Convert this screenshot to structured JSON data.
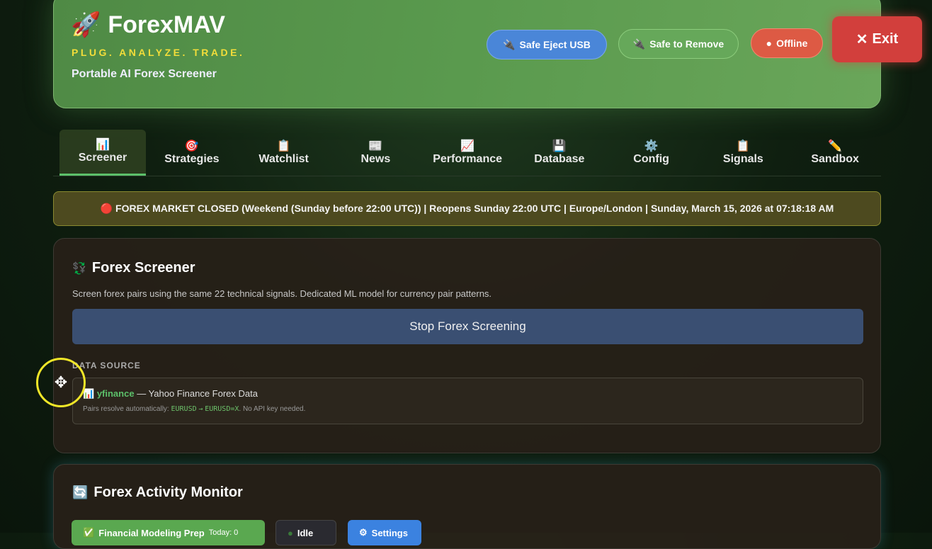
{
  "header": {
    "logo_icon": "rocket",
    "title": "ForexMAV",
    "tagline": "PLUG. ANALYZE. TRADE.",
    "subtitle": "Portable AI Forex Screener",
    "buttons": {
      "eject": "Safe Eject USB",
      "remove": "Safe to Remove",
      "offline": "Offline",
      "exit": "Exit"
    }
  },
  "tabs": [
    {
      "icon": "📊",
      "label": "Screener"
    },
    {
      "icon": "🎯",
      "label": "Strategies"
    },
    {
      "icon": "📋",
      "label": "Watchlist"
    },
    {
      "icon": "📰",
      "label": "News"
    },
    {
      "icon": "📈",
      "label": "Performance"
    },
    {
      "icon": "💾",
      "label": "Database"
    },
    {
      "icon": "⚙️",
      "label": "Config"
    },
    {
      "icon": "📋",
      "label": "Signals"
    },
    {
      "icon": "✏️",
      "label": "Sandbox"
    }
  ],
  "banner": "🔴 FOREX MARKET CLOSED (Weekend (Sunday before 22:00 UTC)) | Reopens Sunday 22:00 UTC | Europe/London | Sunday, March 15, 2026 at 07:18:18 AM",
  "screener": {
    "title": "Forex Screener",
    "description": "Screen forex pairs using the same 22 technical signals. Dedicated ML model for currency pair patterns.",
    "stop_button": "Stop Forex Screening",
    "data_source_label": "DATA SOURCE",
    "source_name": "yfinance",
    "source_desc": "— Yahoo Finance Forex Data",
    "pairs_prefix": "Pairs resolve automatically:",
    "pair_from": "EURUSD",
    "arrow": "→",
    "pair_to": "EURUSD=X",
    "pairs_suffix": ". No API key needed."
  },
  "monitor": {
    "title": "Forex Activity Monitor",
    "fmp_button": "Financial Modeling Prep",
    "fmp_today": "Today: 0",
    "idle": "Idle",
    "settings": "Settings"
  }
}
